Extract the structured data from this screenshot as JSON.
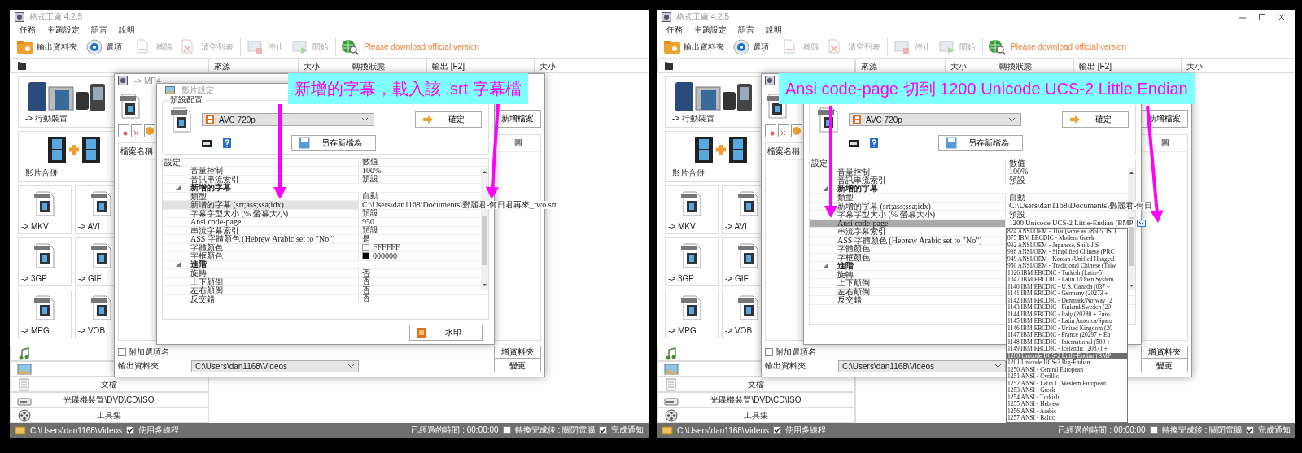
{
  "panels": [
    {
      "window": {
        "title": "格式工廠 4.2.5",
        "controls": false
      },
      "menu": [
        "任務",
        "主題設定",
        "語言",
        "說明"
      ],
      "toolbar": [
        [
          {
            "label": "輸出資料夾",
            "kind": "folder",
            "disabled": false
          },
          {
            "label": "選項",
            "kind": "gear",
            "disabled": false
          }
        ],
        [
          {
            "label": "移除",
            "kind": "remove",
            "disabled": true
          },
          {
            "label": "清空列表",
            "kind": "clear",
            "disabled": true
          }
        ],
        [
          {
            "label": "停止",
            "kind": "stop",
            "disabled": true
          },
          {
            "label": "開始",
            "kind": "start",
            "disabled": true
          }
        ]
      ],
      "download_link": "Please download official version",
      "sidebar": {
        "tiles": [
          {
            "label": "-> 行動裝置",
            "kind": "devices"
          },
          {
            "label": "影片合併",
            "kind": "merge"
          },
          {
            "label": "-> MKV",
            "kind": "file"
          },
          {
            "label": "-> AVI",
            "kind": "file"
          },
          {
            "label": "-> 3GP",
            "kind": "file"
          },
          {
            "label": "-> GIF",
            "kind": "file"
          },
          {
            "label": "-> MPG",
            "kind": "file"
          },
          {
            "label": "-> VOB",
            "kind": "file"
          }
        ],
        "categories": [
          {
            "kind": "audio"
          },
          {
            "kind": "image"
          },
          {
            "kind": "document",
            "label": "文檔"
          },
          {
            "kind": "disc",
            "label": "光碟機裝置\\DVD\\CD\\ISO"
          },
          {
            "kind": "tools",
            "label": "工具集"
          }
        ]
      },
      "file_list": {
        "columns": [
          "來源",
          "大小",
          "轉換狀態",
          "輸出 [F2]",
          "大小"
        ]
      },
      "mp4_dialog": {
        "title": "-> MP4",
        "file_column": "檔案名稱",
        "add_file_button": "新增檔案",
        "preview_column": "圖",
        "append_option": {
          "label": "附加選項名",
          "checked": false
        },
        "folder_button": "增資料夾",
        "output_label": "輸出資料夾",
        "output_path": "C:\\Users\\dan1168\\Videos",
        "change_button": "變更"
      },
      "settings_dialog": {
        "title": "影片設定",
        "preset_group": "預設配置",
        "preset": "AVC 720p",
        "ok_button": "確定",
        "save_as_button": "另存新檔為",
        "columns": [
          "設定",
          "數值"
        ],
        "rows": [
          {
            "kind": "prop",
            "name": "音量控制",
            "value": "100%",
            "selected": false
          },
          {
            "kind": "prop",
            "name": "音訊串流索引",
            "value": "預設",
            "selected": false
          },
          {
            "kind": "group",
            "name": "新增的字幕",
            "expanded": true,
            "selected": false
          },
          {
            "kind": "prop",
            "name": "類型",
            "value": "自動",
            "selected": false
          },
          {
            "kind": "prop",
            "name": "新增的字幕 (srt;ass;ssa;idx)",
            "value": "C:\\Users\\dan1168\\Documents\\鄧麗君-何日君再來_two.srt",
            "selected": true
          },
          {
            "kind": "prop",
            "name": "字幕字型大小 (% 螢幕大小)",
            "value": "預設",
            "selected": false
          },
          {
            "kind": "prop",
            "name": "Ansi code-page",
            "value": "950",
            "selected": false
          },
          {
            "kind": "prop",
            "name": "串流字幕索引",
            "value": "預設",
            "selected": false
          },
          {
            "kind": "prop",
            "name": "ASS 字體顏色 (Hebrew Arabic set to \"No\")",
            "value": "是",
            "selected": false
          },
          {
            "kind": "prop",
            "name": "字體顏色",
            "value": "FFFFFF",
            "color": "#ffffff",
            "selected": false
          },
          {
            "kind": "prop",
            "name": "字框顏色",
            "value": "000000",
            "color": "#000000",
            "selected": false
          },
          {
            "kind": "group",
            "name": "進階",
            "expanded": true,
            "selected": false
          },
          {
            "kind": "prop",
            "name": "旋轉",
            "value": "否",
            "selected": false
          },
          {
            "kind": "prop",
            "name": "上下顛倒",
            "value": "否",
            "selected": false
          },
          {
            "kind": "prop",
            "name": "左右顛倒",
            "value": "否",
            "selected": false
          },
          {
            "kind": "prop",
            "name": "反交錯",
            "value": "否",
            "selected": false
          }
        ],
        "watermark_button": "水印"
      },
      "status_bar": {
        "path": "C:\\Users\\dan1168\\Videos",
        "multithread": {
          "label": "使用多線程",
          "checked": true
        },
        "elapsed": "已經過的時間 : 00:00:00",
        "shutdown": {
          "label": "轉換完成後 : 關閉電腦",
          "checked": false
        },
        "notify": {
          "label": "完成通知",
          "checked": true
        }
      },
      "callout": {
        "text": "新增的字幕，載入該 .srt 字幕檔"
      }
    },
    {
      "window": {
        "title": "格式工廠 4.2.5",
        "controls": true
      },
      "menu": [
        "任務",
        "主題設定",
        "語言",
        "說明"
      ],
      "toolbar": [
        [
          {
            "label": "輸出資料夾",
            "kind": "folder",
            "disabled": false
          },
          {
            "label": "選項",
            "kind": "gear",
            "disabled": false
          }
        ],
        [
          {
            "label": "移除",
            "kind": "remove",
            "disabled": true
          },
          {
            "label": "清空列表",
            "kind": "clear",
            "disabled": true
          }
        ],
        [
          {
            "label": "停止",
            "kind": "stop",
            "disabled": true
          },
          {
            "label": "開始",
            "kind": "start",
            "disabled": true
          }
        ]
      ],
      "download_link": "Please download official version",
      "sidebar": {
        "tiles": [
          {
            "label": "-> 行動裝置",
            "kind": "devices"
          },
          {
            "label": "影片合併",
            "kind": "merge"
          },
          {
            "label": "-> MKV",
            "kind": "file"
          },
          {
            "label": "-> AVI",
            "kind": "file"
          },
          {
            "label": "-> 3GP",
            "kind": "file"
          },
          {
            "label": "-> GIF",
            "kind": "file"
          },
          {
            "label": "-> MPG",
            "kind": "file"
          },
          {
            "label": "-> VOB",
            "kind": "file"
          }
        ],
        "categories": [
          {
            "kind": "audio"
          },
          {
            "kind": "image"
          },
          {
            "kind": "document",
            "label": "文檔"
          },
          {
            "kind": "disc",
            "label": "光碟機裝置\\DVD\\CD\\ISO"
          },
          {
            "kind": "tools",
            "label": "工具集"
          }
        ]
      },
      "file_list": {
        "columns": [
          "來源",
          "大小",
          "轉換狀態",
          "輸出 [F2]",
          "大小"
        ]
      },
      "mp4_dialog": {
        "file_column": "檔案名稱",
        "add_file_button": "新增檔案",
        "preview_column": "圖",
        "append_option": {
          "label": "附加選項名",
          "checked": false
        },
        "folder_button": "增資料夾",
        "output_label": "輸出資料夾",
        "output_path": "C:\\Users\\dan1168\\Videos",
        "change_button": "變更"
      },
      "settings_dialog": {
        "preset": "AVC 720p",
        "ok_button": "確定",
        "save_as_button": "另存新檔為",
        "columns": [
          "設定",
          "數值"
        ],
        "rows": [
          {
            "kind": "prop",
            "name": "音量控制",
            "value": "100%",
            "selected": false
          },
          {
            "kind": "prop",
            "name": "音訊串流索引",
            "value": "預設",
            "selected": false
          },
          {
            "kind": "group",
            "name": "新增的字幕",
            "expanded": true,
            "selected": false
          },
          {
            "kind": "prop",
            "name": "類型",
            "value": "自動",
            "selected": false
          },
          {
            "kind": "prop",
            "name": "新增的字幕 (srt;ass;ssa;idx)",
            "value": "C:\\Users\\dan1168\\Documents\\鄧麗君-何日",
            "selected": false
          },
          {
            "kind": "prop",
            "name": "字幕字型大小 (% 螢幕大小)",
            "value": "預設",
            "selected": false
          },
          {
            "kind": "prop",
            "name": "Ansi code-page",
            "value": "1200 Unicode UCS-2 Little-Endian (BMP",
            "selected": true,
            "options": [
              {
                "label": "874 ANSI/OEM - Thai (same as 28605, ISO",
                "selected": false
              },
              {
                "label": "875 IBM EBCDIC - Modern Greek",
                "selected": false
              },
              {
                "label": "932 ANSI/OEM - Japanese, Shift-JIS",
                "selected": false
              },
              {
                "label": "936 ANSI/OEM - Simplified Chinese (PRC",
                "selected": false
              },
              {
                "label": "949 ANSI/OEM - Korean (Unified Hangeul",
                "selected": false
              },
              {
                "label": "950 ANSI/OEM - Traditional Chinese (Taiw",
                "selected": false
              },
              {
                "label": "1026 IBM EBCDIC - Turkish (Latin-5)",
                "selected": false
              },
              {
                "label": "1047 IBM EBCDIC - Latin 1/Open System",
                "selected": false
              },
              {
                "label": "1140 IBM EBCDIC - U.S./Canada (037 +",
                "selected": false
              },
              {
                "label": "1141 IBM EBCDIC - Germany (20273 +",
                "selected": false
              },
              {
                "label": "1142 IBM EBCDIC - Denmark/Norway (2",
                "selected": false
              },
              {
                "label": "1143 IBM EBCDIC - Finland/Sweden (20",
                "selected": false
              },
              {
                "label": "1144 IBM EBCDIC - Italy (20280 + Euro",
                "selected": false
              },
              {
                "label": "1145 IBM EBCDIC - Latin America/Spain",
                "selected": false
              },
              {
                "label": "1146 IBM EBCDIC - United Kingdom (20",
                "selected": false
              },
              {
                "label": "1147 IBM EBCDIC - France (20297 + Eu",
                "selected": false
              },
              {
                "label": "1148 IBM EBCDIC - International (500 +",
                "selected": false
              },
              {
                "label": "1149 IBM EBCDIC - Icelandic (20871 +",
                "selected": false
              },
              {
                "label": "1200 Unicode UCS-2 Little-Endian (BMP",
                "selected": true
              },
              {
                "label": "1201 Unicode UCS-2 Big-Endian",
                "selected": false
              },
              {
                "label": "1250 ANSI - Central European",
                "selected": false
              },
              {
                "label": "1251 ANSI - Cyrillic",
                "selected": false
              },
              {
                "label": "1252 ANSI - Latin I , Western European",
                "selected": false
              },
              {
                "label": "1253 ANSI - Greek",
                "selected": false
              },
              {
                "label": "1254 ANSI - Turkish",
                "selected": false
              },
              {
                "label": "1255 ANSI - Hebrew",
                "selected": false
              },
              {
                "label": "1256 ANSI - Arabic",
                "selected": false
              },
              {
                "label": "1257 ANSI - Baltic",
                "selected": false
              }
            ]
          },
          {
            "kind": "prop",
            "name": "串流字幕索引",
            "selected": false
          },
          {
            "kind": "prop",
            "name": "ASS 字體顏色 (Hebrew Arabic set to \"No\")",
            "selected": false
          },
          {
            "kind": "prop",
            "name": "字體顏色",
            "selected": false
          },
          {
            "kind": "prop",
            "name": "字框顏色",
            "selected": false
          },
          {
            "kind": "group",
            "name": "進階",
            "expanded": true,
            "selected": false
          },
          {
            "kind": "prop",
            "name": "旋轉",
            "selected": false
          },
          {
            "kind": "prop",
            "name": "上下顛倒",
            "selected": false
          },
          {
            "kind": "prop",
            "name": "左右顛倒",
            "selected": false
          },
          {
            "kind": "prop",
            "name": "反交錯",
            "selected": false
          }
        ]
      },
      "status_bar": {
        "path": "C:\\Users\\dan1168\\Videos",
        "multithread": {
          "label": "使用多線程",
          "checked": true
        },
        "elapsed": "已經過的時間 : 00:00:00",
        "shutdown": {
          "label": "轉換完成後 : 關閉電腦",
          "checked": false
        },
        "notify": {
          "label": "完成通知",
          "checked": true
        }
      },
      "callout": {
        "text": "Ansi code-page 切到 1200 Unicode UCS-2 Little Endian"
      }
    }
  ]
}
